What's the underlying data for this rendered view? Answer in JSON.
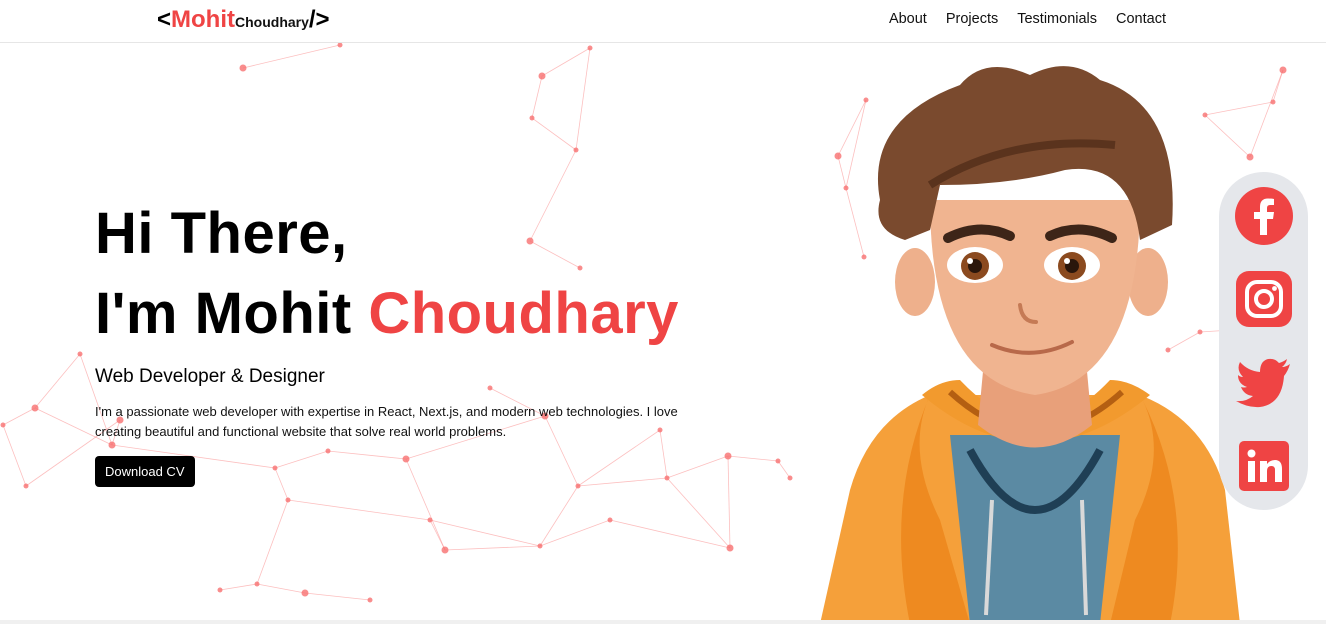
{
  "nav": {
    "logo_open": "<",
    "logo_brand": "Mohit",
    "logo_sub": "Choudhary",
    "logo_close": "/>",
    "links": [
      "About",
      "Projects",
      "Testimonials",
      "Contact"
    ]
  },
  "hero": {
    "line1": "Hi There,",
    "line2_prefix": "I'm Mohit ",
    "line2_accent": "Choudhary",
    "role": "Web Developer & Designer",
    "description": "I'm a passionate web developer with expertise in React, Next.js, and modern web technologies. I love creating beautiful and functional website that solve real world problems.",
    "cta": "Download CV"
  },
  "social": [
    "facebook-icon",
    "instagram-icon",
    "twitter-icon",
    "linkedin-icon"
  ],
  "colors": {
    "accent": "#ef4444",
    "button": "#000000",
    "social_bg": "#e5e7eb",
    "network": "#f87171"
  }
}
